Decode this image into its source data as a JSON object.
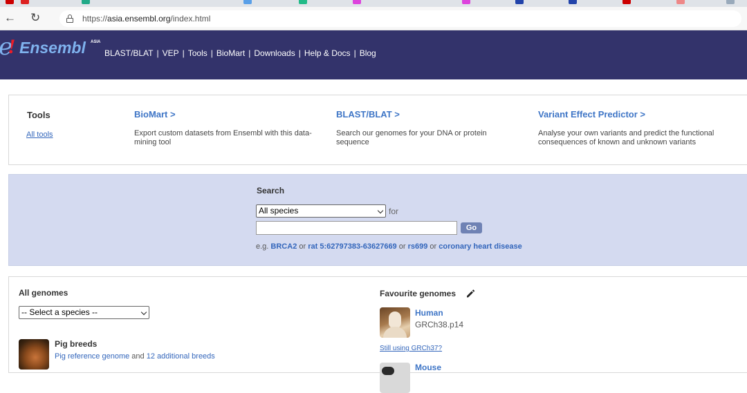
{
  "browser": {
    "url_prefix": "https://",
    "url_host": "asia.ensembl.org",
    "url_path": "/index.html",
    "back_icon": "back-arrow-icon",
    "reload_icon": "reload-icon",
    "lock_icon": "lock-icon"
  },
  "masthead": {
    "logo_e": "e",
    "logo_bang": "!",
    "logo_word": "Ensembl",
    "logo_sub": "ASIA",
    "nav": [
      "BLAST/BLAT",
      "VEP",
      "Tools",
      "BioMart",
      "Downloads",
      "Help & Docs",
      "Blog"
    ],
    "background": "#33336b"
  },
  "tools": {
    "title": "Tools",
    "all_tools": "All tools",
    "items": [
      {
        "name": "BioMart >",
        "desc": "Export custom datasets from Ensembl with this data-mining tool"
      },
      {
        "name": "BLAST/BLAT >",
        "desc": "Search our genomes for your DNA or protein sequence"
      },
      {
        "name": "Variant Effect Predictor >",
        "desc": "Analyse your own variants and predict the functional consequences of known and unknown variants"
      }
    ]
  },
  "search": {
    "title": "Search",
    "species_selected": "All species",
    "for_label": "for",
    "query_value": "",
    "go_label": "Go",
    "eg_prefix": "e.g.",
    "examples": [
      "BRCA2",
      "rat 5:62797383-63627669",
      "rs699",
      "coronary heart disease"
    ],
    "or_word": "or",
    "panel_color": "#d4daf0"
  },
  "genomes": {
    "all_title": "All genomes",
    "select_placeholder": "-- Select a species --",
    "pig": {
      "name": "Pig breeds",
      "link1": "Pig reference genome",
      "and_word": "and",
      "link2": "12 additional breeds"
    },
    "favourites_title": "Favourite genomes",
    "edit_icon": "pencil-icon",
    "human": {
      "name": "Human",
      "assembly": "GRCh38.p14"
    },
    "grch37_link": "Still using GRCh37?",
    "mouse": {
      "name": "Mouse"
    }
  }
}
